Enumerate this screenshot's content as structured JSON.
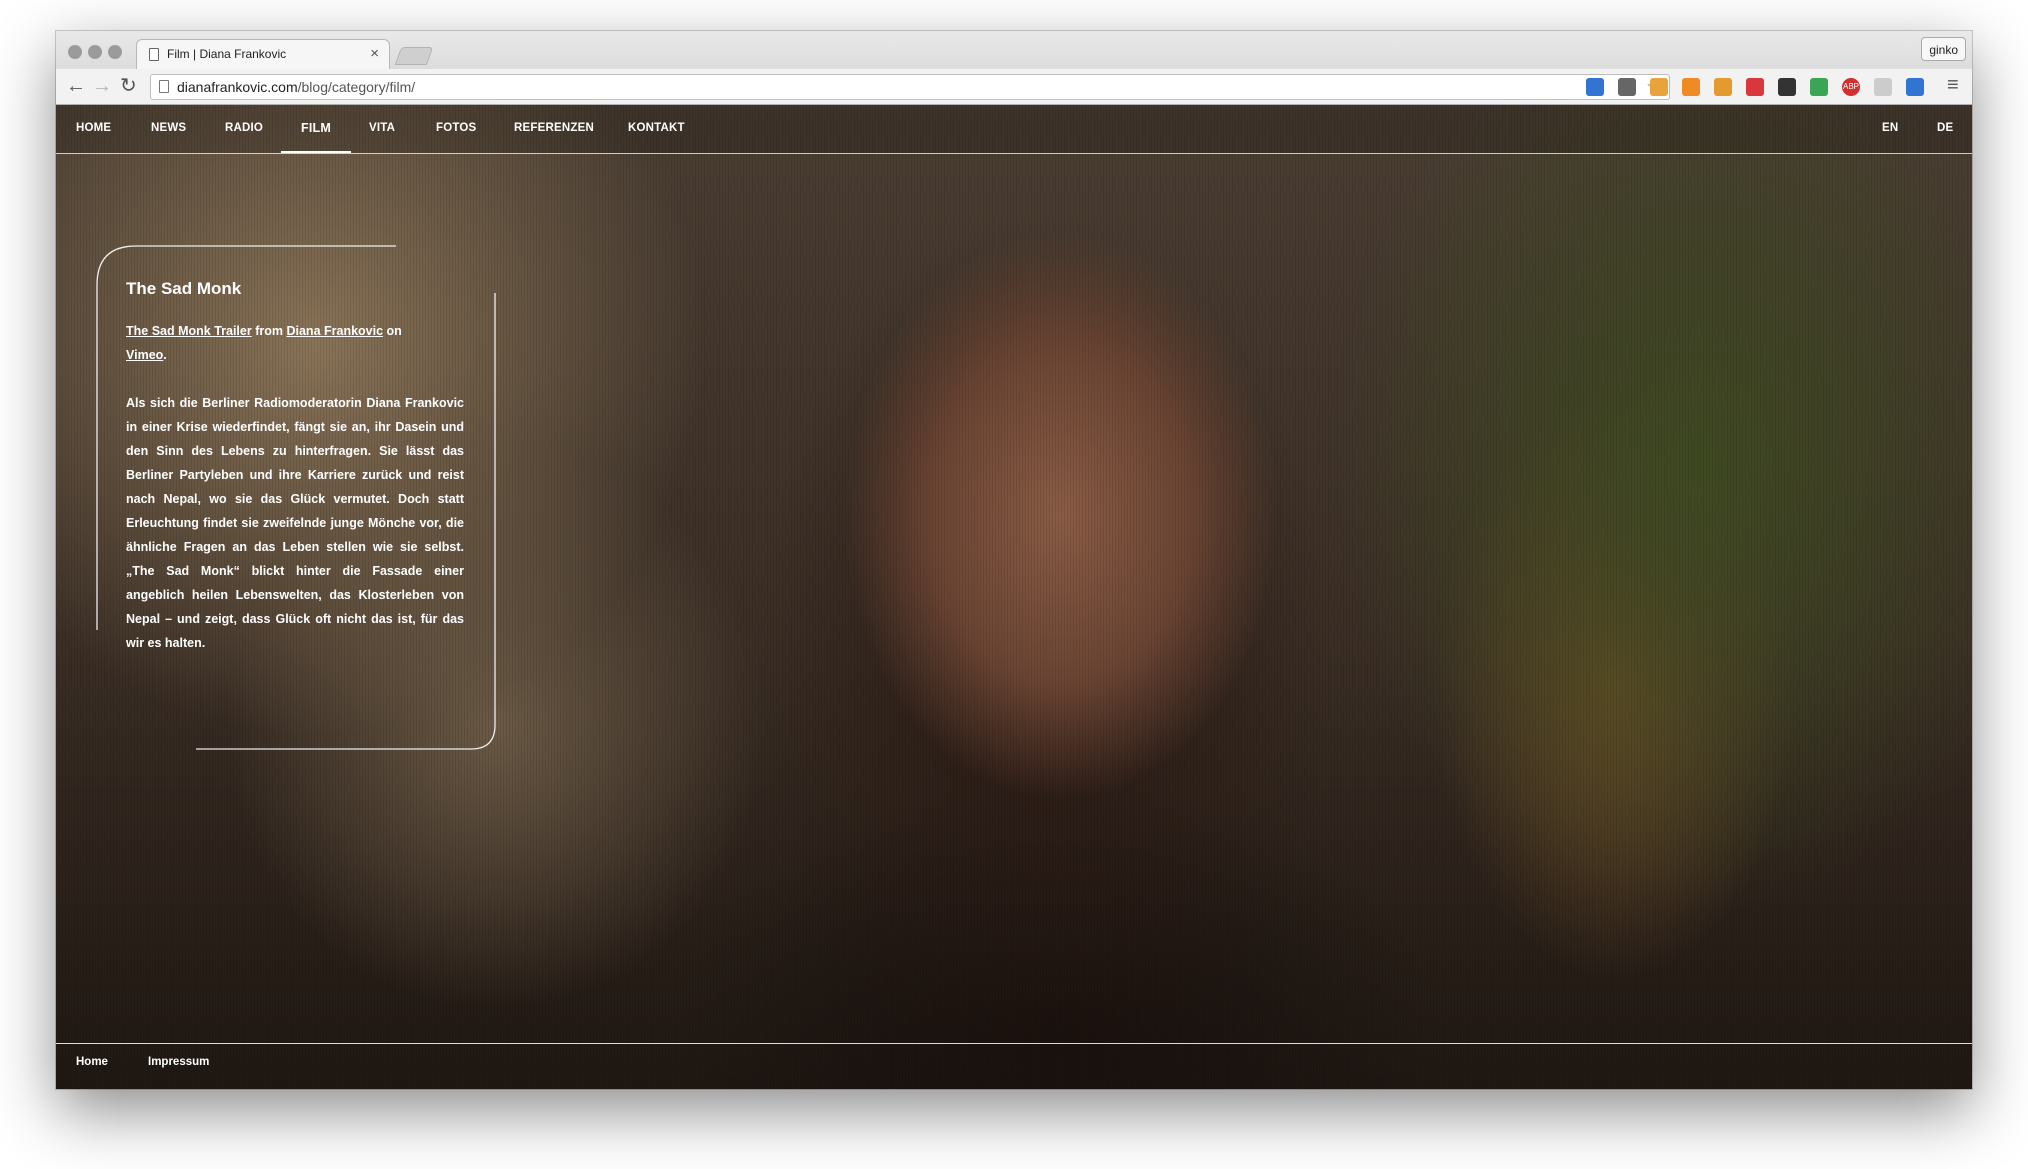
{
  "browser": {
    "tab_title": "Film | Diana Frankovic",
    "tab_close": "×",
    "profile_name": "ginko",
    "url_domain": "dianafrankovic.com",
    "url_path": "/blog/category/film/",
    "back_glyph": "←",
    "forward_glyph": "→",
    "reload_glyph": "↻",
    "star_glyph": "☆",
    "extensions": [
      {
        "icon": "delicious-icon",
        "color": "#3274d1"
      },
      {
        "icon": "eyedropper-icon",
        "color": "#666666"
      },
      {
        "icon": "bookmark-tag-icon",
        "color": "#e8a33b"
      },
      {
        "icon": "chart-icon",
        "color": "#f08a24"
      },
      {
        "icon": "lock-icon",
        "color": "#e39a2e"
      },
      {
        "icon": "grid-icon",
        "color": "#d9363e"
      },
      {
        "icon": "star-filled-icon",
        "color": "#333333"
      },
      {
        "icon": "color-palette-icon",
        "color": "#3aa655"
      },
      {
        "icon": "adblock-icon",
        "color": "#d32f2f",
        "label": "ABP"
      },
      {
        "icon": "inactive-extension-icon",
        "color": "#cccccc"
      },
      {
        "icon": "delicious-icon-2",
        "color": "#3274d1"
      }
    ],
    "menu_glyph": "≡"
  },
  "nav": {
    "items": [
      "HOME",
      "NEWS",
      "RADIO",
      "FILM",
      "VITA",
      "FOTOS",
      "REFERENZEN",
      "KONTAKT"
    ],
    "active": "FILM",
    "lang_en": "EN",
    "lang_de": "DE"
  },
  "post": {
    "title": "The Sad Monk",
    "trailer_link": "The Sad Monk Trailer",
    "from": "from",
    "author_link": "Diana Frankovic",
    "on": "on",
    "vimeo_link": "Vimeo",
    "period": ".",
    "description": "Als sich die Berliner Radiomoderatorin Diana Frankovic in einer Krise wiederfindet, fängt sie an, ihr Dasein und den Sinn des Lebens zu hinterfragen. Sie lässt das Berliner Partyleben und ihre Karriere zurück und reist nach Nepal, wo sie das Glück vermutet. Doch statt Erleuchtung findet sie zweifelnde junge Mönche vor, die ähnliche Fragen an das Leben stellen wie sie selbst. „The Sad Monk“ blickt hinter die Fassade einer angeblich heilen Lebenswelten, das Klosterleben von Nepal – und zeigt, dass Glück oft nicht das ist, für das wir es halten."
  },
  "footer": {
    "home": "Home",
    "impressum": "Impressum"
  },
  "colors": {
    "text": "#ffffff",
    "chrome": "#e6e6e6"
  }
}
